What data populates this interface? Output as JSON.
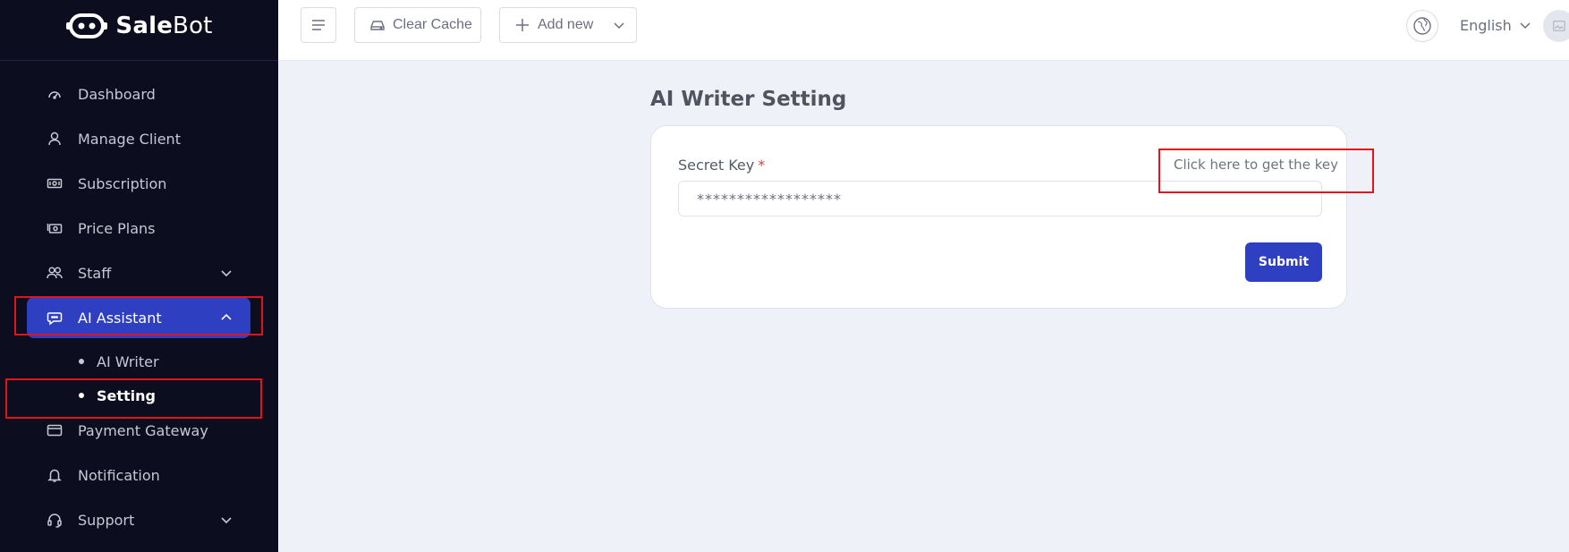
{
  "brand": {
    "name_bold": "Sale",
    "name_regular": "Bot"
  },
  "sidebar": {
    "items": [
      {
        "label": "Dashboard",
        "icon": "dashboard-icon"
      },
      {
        "label": "Manage Client",
        "icon": "user-icon"
      },
      {
        "label": "Subscription",
        "icon": "money-icon"
      },
      {
        "label": "Price Plans",
        "icon": "price-plans-icon"
      },
      {
        "label": "Staff",
        "icon": "users-icon"
      },
      {
        "label": "AI Assistant",
        "icon": "chat-icon"
      },
      {
        "label": "Payment Gateway",
        "icon": "card-icon"
      },
      {
        "label": "Notification",
        "icon": "bell-icon"
      },
      {
        "label": "Support",
        "icon": "headset-icon"
      }
    ],
    "sub_items": [
      {
        "label": "AI Writer"
      },
      {
        "label": "Setting"
      }
    ]
  },
  "topbar": {
    "clear_cache_label": "Clear Cache",
    "add_new_label": "Add new",
    "language": "English"
  },
  "main": {
    "title": "AI Writer Setting",
    "secret_key_label": "Secret Key",
    "required_mark": "*",
    "get_key_link": "Click here to get the key",
    "secret_key_value": "******************",
    "submit_label": "Submit"
  },
  "colors": {
    "sidebar_bg": "#0c0d1f",
    "accent": "#2f3fc2",
    "annotation": "#e0141a"
  }
}
